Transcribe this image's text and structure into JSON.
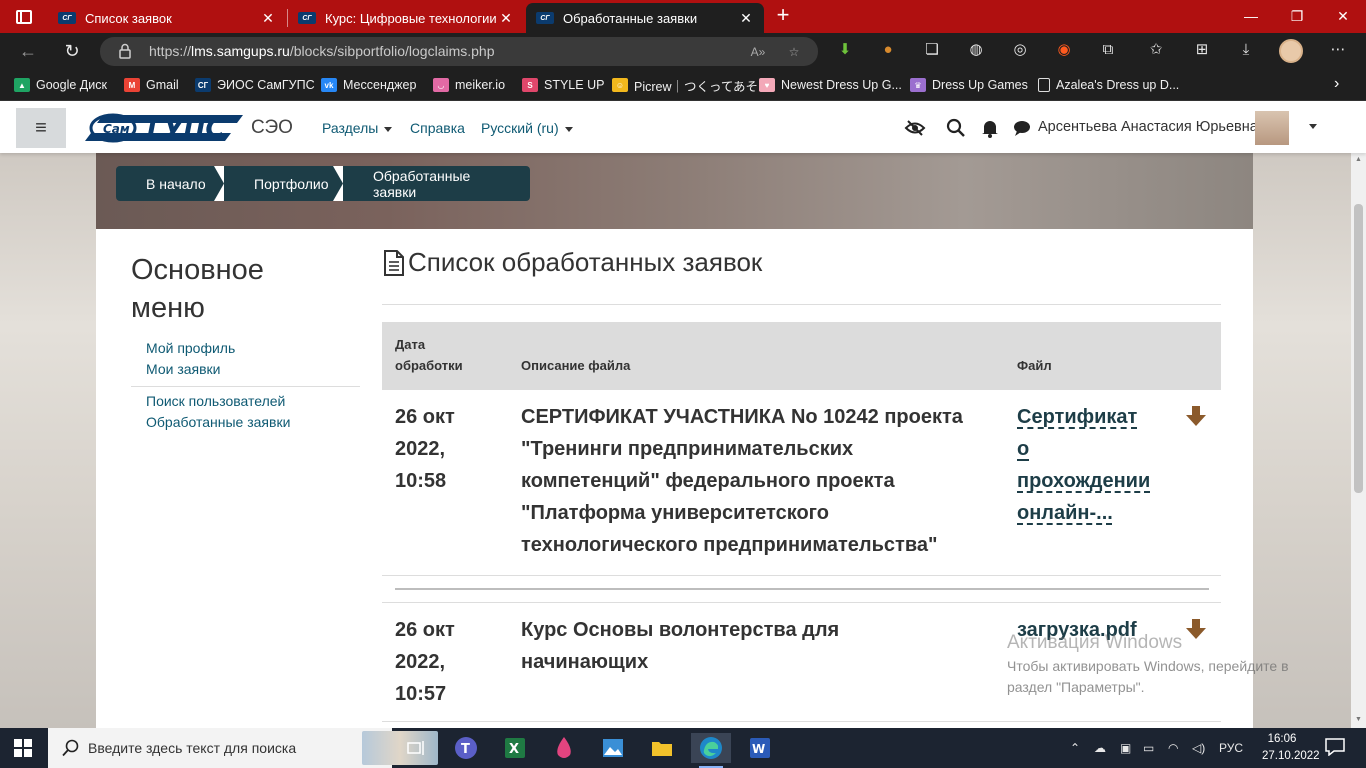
{
  "browser": {
    "tabs": [
      {
        "title": "Список заявок",
        "active": false
      },
      {
        "title": "Курс: Цифровые технологии са",
        "active": false
      },
      {
        "title": "Обработанные заявки",
        "active": true
      }
    ],
    "url_prefix": "https://",
    "url_host": "lms.samgups.ru",
    "url_path": "/blocks/sibportfolio/logclaims.php",
    "bookmarks": [
      {
        "label": "Google Диск",
        "icon": "google-drive-icon",
        "color": "#1fa463"
      },
      {
        "label": "Gmail",
        "icon": "gmail-icon",
        "color": "#ea4335"
      },
      {
        "label": "ЭИОС СамГУПС",
        "icon": "samgups-icon",
        "color": "#0b3b6e"
      },
      {
        "label": "Мессенджер",
        "icon": "vk-icon",
        "color": "#2787f5"
      },
      {
        "label": "meiker.io",
        "icon": "meiker-icon",
        "color": "#e26aa5"
      },
      {
        "label": "STYLE UP",
        "icon": "styleup-icon",
        "color": "#e0476b"
      },
      {
        "label": "Picrew｜つくってあそ...",
        "icon": "picrew-icon",
        "color": "#f2b81d"
      },
      {
        "label": "Newest Dress Up G...",
        "icon": "dressup-icon",
        "color": "#f3a8b8"
      },
      {
        "label": "Dress Up Games",
        "icon": "dressup-games-icon",
        "color": "#9b6fcf"
      },
      {
        "label": "Azalea's Dress up D...",
        "icon": "page-icon",
        "color": "#dddddd"
      }
    ]
  },
  "navbar": {
    "site_name": "СЭО",
    "menu_sections": "Разделы",
    "menu_help": "Справка",
    "menu_language": "Русский (ru)",
    "user_name": "Арсентьева Анастасия Юрьевна"
  },
  "breadcrumb": [
    "В начало",
    "Портфолио",
    "Обработанные заявки"
  ],
  "sidebar": {
    "title": "Основное меню",
    "group1": [
      "Мой профиль",
      "Мои заявки"
    ],
    "group2": [
      "Поиск пользователей",
      "Обработанные заявки"
    ]
  },
  "main": {
    "page_title": "Список обработанных заявок",
    "columns": {
      "date_line1": "Дата",
      "date_line2": "обработки",
      "description": "Описание файла",
      "file": "Файл"
    },
    "rows": [
      {
        "date_lines": [
          "26 окт",
          "2022,",
          "10:58"
        ],
        "description_lines": [
          "СЕРТИФИКАТ УЧАСТНИКА No 10242 проекта",
          "\"Тренинги предпринимательских",
          "компетенций\" федерального проекта",
          "\"Платформа университетского",
          "технологического предпринимательства\""
        ],
        "file_lines": [
          "Сертификат",
          "о",
          "прохождении",
          "онлайн-..."
        ]
      },
      {
        "date_lines": [
          "26 окт",
          "2022,",
          "10:57"
        ],
        "description_lines": [
          "Курс Основы волонтерства для",
          "начинающих"
        ],
        "file_lines": [
          "загрузка.pdf"
        ]
      }
    ]
  },
  "watermark": {
    "line1": "Активация Windows",
    "line2": "Чтобы активировать Windows, перейдите в раздел \"Параметры\"."
  },
  "taskbar": {
    "search_placeholder": "Введите здесь текст для поиска",
    "language": "РУС",
    "time": "16:06",
    "date": "27.10.2022"
  },
  "colors": {
    "tab_bar": "#b01010",
    "chrome_dark": "#1f1f1f",
    "breadcrumb_bg": "#1d3d47",
    "link": "#0f5a73",
    "download_arrow": "#8b5a2b",
    "taskbar": "#1c2431"
  }
}
